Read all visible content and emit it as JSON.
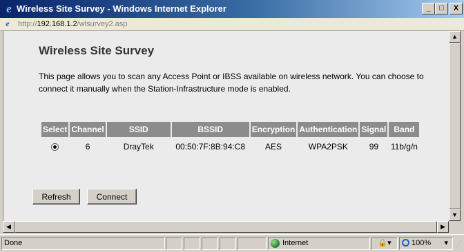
{
  "window": {
    "title": "Wireless Site Survey - Windows Internet Explorer",
    "controls": {
      "minimize": "_",
      "maximize": "□",
      "close": "X"
    }
  },
  "address": {
    "scheme": "http://",
    "host": "192.168.1.2",
    "path": "/wlsurvey2.asp"
  },
  "page": {
    "title": "Wireless Site Survey",
    "description": "This page allows you to scan any Access Point or IBSS available on wireless network. You can choose to connect it manually when the Station-Infrastructure mode is enabled."
  },
  "table": {
    "headers": [
      "Select",
      "Channel",
      "SSID",
      "BSSID",
      "Encryption",
      "Authentication",
      "Signal",
      "Band"
    ],
    "rows": [
      {
        "selected": true,
        "channel": "6",
        "ssid": "DrayTek",
        "bssid": "00:50:7F:8B:94:C8",
        "encryption": "AES",
        "authentication": "WPA2PSK",
        "signal": "99",
        "band": "11b/g/n"
      }
    ]
  },
  "buttons": {
    "refresh": "Refresh",
    "connect": "Connect"
  },
  "scrollbars": {
    "up_arrow": "▲",
    "down_arrow": "▼",
    "left_arrow": "◀",
    "right_arrow": "▶"
  },
  "status": {
    "text": "Done",
    "zone": "Internet",
    "protected_mode_icon": "🔒▾",
    "zoom": "100%",
    "zoom_dropdown": "▾"
  }
}
